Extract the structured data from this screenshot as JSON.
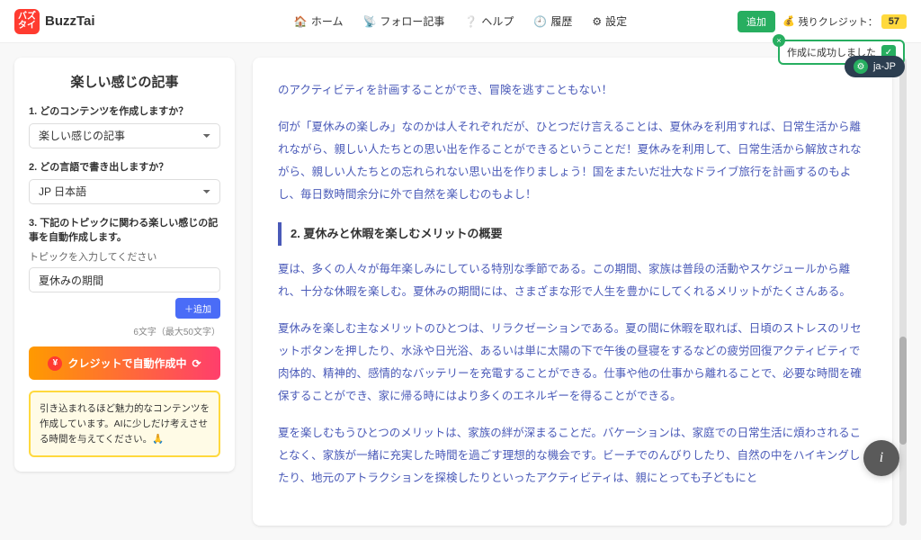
{
  "brand": {
    "badge": "バズ\nタイ",
    "name": "BuzzTai"
  },
  "nav": {
    "home": "ホーム",
    "follow": "フォロー記事",
    "help": "ヘルプ",
    "history": "履歴",
    "settings": "設定"
  },
  "header": {
    "add": "追加",
    "credit_label": "残りクレジット：",
    "credit_value": "57"
  },
  "toast": {
    "message": "作成に成功しました"
  },
  "lang": {
    "code": "ja-JP"
  },
  "form": {
    "title": "楽しい感じの記事",
    "q1_label": "1. どのコンテンツを作成しますか？",
    "q1_value": "楽しい感じの記事",
    "q2_label": "2. どの言語で書き出しますか？",
    "q2_value": "JP 日本語",
    "q3_label": "3. 下記のトピックに関わる楽しい感じの記事を自動作成します。",
    "topic_placeholder": "トピックを入力してください",
    "topic_value": "夏休みの期間",
    "add_btn": "＋追加",
    "char_count": "6文字（最大50文字）",
    "generate_btn": "クレジットで自動作成中",
    "info_text": "引き込まれるほど魅力的なコンテンツを作成しています。AIに少しだけ考えさせる時間を与えてください。🙏"
  },
  "content": {
    "p1": "のアクティビティを計画することができ、冒険を逃すこともない！",
    "p2": "何が「夏休みの楽しみ」なのかは人それぞれだが、ひとつだけ言えることは、夏休みを利用すれば、日常生活から離れながら、親しい人たちとの思い出を作ることができるということだ！夏休みを利用して、日常生活から解放されながら、親しい人たちとの忘れられない思い出を作りましょう！国をまたいだ壮大なドライブ旅行を計画するのもよし、毎日数時間余分に外で自然を楽しむのもよし！",
    "h2": "2. 夏休みと休暇を楽しむメリットの概要",
    "p3": "夏は、多くの人々が毎年楽しみにしている特別な季節である。この期間、家族は普段の活動やスケジュールから離れ、十分な休暇を楽しむ。夏休みの期間には、さまざまな形で人生を豊かにしてくれるメリットがたくさんある。",
    "p4": "夏休みを楽しむ主なメリットのひとつは、リラクゼーションである。夏の間に休暇を取れば、日頃のストレスのリセットボタンを押したり、水泳や日光浴、あるいは単に太陽の下で午後の昼寝をするなどの疲労回復アクティビティで肉体的、精神的、感情的なバッテリーを充電することができる。仕事や他の仕事から離れることで、必要な時間を確保することができ、家に帰る時にはより多くのエネルギーを得ることができる。",
    "p5": "夏を楽しむもうひとつのメリットは、家族の絆が深まることだ。バケーションは、家庭での日常生活に煩わされることなく、家族が一緒に充実した時間を過ごす理想的な機会です。ビーチでのんびりしたり、自然の中をハイキングしたり、地元のアトラクションを探検したりといったアクティビティは、親にとっても子どもにと"
  }
}
